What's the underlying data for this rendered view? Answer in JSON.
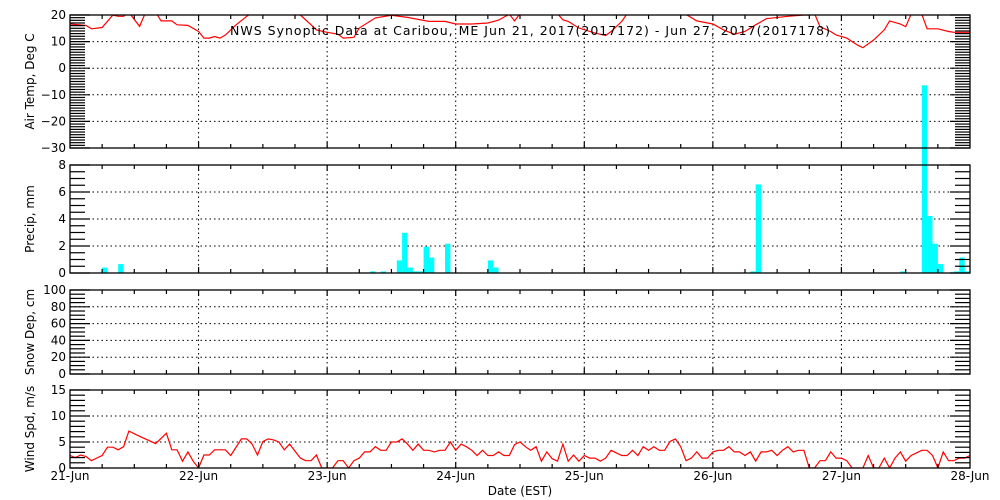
{
  "chart_data": {
    "title": "NWS Synoptic Data at Caribou, ME   Jun 21, 2017(2017172) - Jun 27, 2017(2017178)",
    "xlabel": "Date (EST)",
    "x_units": "hours since 21-Jun 00:00 EST",
    "xlim": [
      0,
      168
    ],
    "xtick_values": [
      0,
      24,
      48,
      72,
      96,
      120,
      144,
      168
    ],
    "xtick_labels": [
      "21-Jun",
      "22-Jun",
      "23-Jun",
      "24-Jun",
      "25-Jun",
      "26-Jun",
      "27-Jun",
      "28-Jun"
    ],
    "grid": true,
    "panels": [
      {
        "type": "line",
        "id": "air-temp",
        "ylabel": "Air Temp, Deg C",
        "ylim": [
          -30,
          20
        ],
        "ytick_values": [
          20,
          10,
          0,
          -10,
          -20,
          -30
        ],
        "ytick_labels": [
          "20",
          "10",
          "0",
          "−10",
          "−20",
          "−30"
        ],
        "color": "#ff0000",
        "points": [
          [
            0,
            16.6
          ],
          [
            3,
            16.1
          ],
          [
            4,
            14.8
          ],
          [
            6,
            15.3
          ],
          [
            8,
            20
          ],
          [
            9,
            19.5
          ],
          [
            10,
            19.5
          ],
          [
            11,
            21
          ],
          [
            13,
            15.7
          ],
          [
            14,
            20.5
          ],
          [
            16,
            21
          ],
          [
            17,
            17.8
          ],
          [
            19,
            17.8
          ],
          [
            20,
            16.3
          ],
          [
            22,
            16.1
          ],
          [
            24,
            13.8
          ],
          [
            25,
            11.3
          ],
          [
            26,
            11.3
          ],
          [
            27,
            11.9
          ],
          [
            28,
            11.3
          ],
          [
            29,
            12.5
          ],
          [
            31,
            16.3
          ],
          [
            33,
            19.5
          ],
          [
            34,
            21
          ],
          [
            38,
            22
          ],
          [
            43,
            20
          ],
          [
            45,
            16.3
          ],
          [
            46,
            14.4
          ],
          [
            48,
            13.5
          ],
          [
            50,
            12.8
          ],
          [
            51,
            11.3
          ],
          [
            53,
            11.6
          ],
          [
            54,
            15.1
          ],
          [
            57,
            18.9
          ],
          [
            60,
            19.9
          ],
          [
            63,
            19.1
          ],
          [
            67,
            17.6
          ],
          [
            70,
            17.6
          ],
          [
            72,
            16.6
          ],
          [
            75,
            16.6
          ],
          [
            78,
            17
          ],
          [
            80,
            18.1
          ],
          [
            82,
            20.3
          ],
          [
            83,
            17.8
          ],
          [
            84,
            20.5
          ],
          [
            88,
            22
          ],
          [
            91,
            20.5
          ],
          [
            92,
            18.2
          ],
          [
            93,
            17.6
          ],
          [
            95,
            15.1
          ],
          [
            98,
            13.2
          ],
          [
            100,
            12.3
          ],
          [
            101,
            13.8
          ],
          [
            103,
            17.6
          ],
          [
            104,
            20.5
          ],
          [
            109,
            22
          ],
          [
            115,
            20.2
          ],
          [
            117,
            17.8
          ],
          [
            120,
            16.6
          ],
          [
            122,
            14.4
          ],
          [
            124,
            12.8
          ],
          [
            126,
            13.8
          ],
          [
            128,
            16.3
          ],
          [
            130,
            18.6
          ],
          [
            134,
            19.5
          ],
          [
            137,
            20
          ],
          [
            138,
            20
          ],
          [
            139,
            20.5
          ],
          [
            140,
            15.6
          ],
          [
            142,
            13.8
          ],
          [
            143,
            12.5
          ],
          [
            145,
            11.3
          ],
          [
            147,
            8.7
          ],
          [
            148,
            7.7
          ],
          [
            150,
            10.6
          ],
          [
            152,
            14.4
          ],
          [
            153,
            17.8
          ],
          [
            155,
            16.6
          ],
          [
            156,
            15.6
          ],
          [
            157,
            20.3
          ],
          [
            158,
            22
          ],
          [
            159,
            20.3
          ],
          [
            160,
            14.8
          ],
          [
            162,
            14.8
          ],
          [
            164,
            13.8
          ],
          [
            165,
            13.5
          ],
          [
            168,
            13.5
          ]
        ]
      },
      {
        "type": "bar",
        "id": "precip",
        "ylabel": "Precip, mm",
        "ylim": [
          0,
          8
        ],
        "ytick_values": [
          0,
          2,
          4,
          6,
          8
        ],
        "ytick_labels": [
          "0",
          "2",
          "4",
          "6",
          "8"
        ],
        "color": "#00ffff",
        "bar_width_hours": 1,
        "bars": [
          [
            6,
            0.4
          ],
          [
            9,
            0.66
          ],
          [
            56,
            0.12
          ],
          [
            58,
            0.12
          ],
          [
            61,
            0.93
          ],
          [
            62,
            2.98
          ],
          [
            63,
            0.41
          ],
          [
            64,
            0.12
          ],
          [
            65,
            0.12
          ],
          [
            66,
            1.95
          ],
          [
            67,
            1.15
          ],
          [
            70,
            2.17
          ],
          [
            78,
            0.93
          ],
          [
            79,
            0.41
          ],
          [
            127,
            0.12
          ],
          [
            128,
            6.56
          ],
          [
            155,
            0.12
          ],
          [
            159,
            13.9
          ],
          [
            160,
            4.22
          ],
          [
            161,
            2.17
          ],
          [
            162,
            0.66
          ],
          [
            165,
            0.12
          ],
          [
            166,
            1.15
          ],
          [
            167,
            0.12
          ]
        ]
      },
      {
        "type": "line",
        "id": "snow-depth",
        "ylabel": "Snow Dep, cm",
        "ylim": [
          0,
          100
        ],
        "ytick_values": [
          0,
          20,
          40,
          60,
          80,
          100
        ],
        "ytick_labels": [
          "0",
          "20",
          "40",
          "60",
          "80",
          "100"
        ],
        "color": "#ff0000",
        "points": []
      },
      {
        "type": "line",
        "id": "wind-speed",
        "ylabel": "Wind Spd, m/s",
        "ylim": [
          0,
          15
        ],
        "ytick_values": [
          0,
          5,
          10,
          15
        ],
        "ytick_labels": [
          "0",
          "5",
          "10",
          "15"
        ],
        "color": "#ff0000",
        "points": [
          [
            0,
            2.4
          ],
          [
            1,
            2.0
          ],
          [
            2,
            2.5
          ],
          [
            3,
            2.2
          ],
          [
            4,
            1.4
          ],
          [
            6,
            2.4
          ],
          [
            7,
            4.0
          ],
          [
            8,
            4.0
          ],
          [
            9,
            3.5
          ],
          [
            10,
            4.1
          ],
          [
            11,
            7.1
          ],
          [
            13,
            6.1
          ],
          [
            16,
            4.7
          ],
          [
            18,
            6.7
          ],
          [
            19,
            3.5
          ],
          [
            20,
            3.5
          ],
          [
            21,
            1.3
          ],
          [
            22,
            3.1
          ],
          [
            23,
            1.3
          ],
          [
            24,
            0
          ],
          [
            25,
            2.5
          ],
          [
            26,
            2.5
          ],
          [
            27,
            3.5
          ],
          [
            29,
            3.5
          ],
          [
            30,
            2.4
          ],
          [
            32,
            5.6
          ],
          [
            33,
            5.6
          ],
          [
            34,
            4.6
          ],
          [
            35,
            2.5
          ],
          [
            36,
            5.1
          ],
          [
            37,
            5.6
          ],
          [
            38,
            5.4
          ],
          [
            39,
            5.0
          ],
          [
            40,
            3.5
          ],
          [
            41,
            4.6
          ],
          [
            43,
            1.9
          ],
          [
            44,
            1.4
          ],
          [
            45,
            1.4
          ],
          [
            46,
            2.5
          ],
          [
            47,
            0
          ],
          [
            48,
            0
          ],
          [
            49,
            0
          ],
          [
            50,
            1.4
          ],
          [
            51,
            1.4
          ],
          [
            52,
            0
          ],
          [
            53,
            1.4
          ],
          [
            54,
            1.9
          ],
          [
            55,
            3.1
          ],
          [
            56,
            3.1
          ],
          [
            57,
            4.1
          ],
          [
            58,
            3.4
          ],
          [
            59,
            3.4
          ],
          [
            60,
            5.0
          ],
          [
            61,
            5.0
          ],
          [
            62,
            5.6
          ],
          [
            63,
            4.6
          ],
          [
            64,
            3.4
          ],
          [
            65,
            4.6
          ],
          [
            66,
            3.4
          ],
          [
            67,
            3.4
          ],
          [
            68,
            3.1
          ],
          [
            69,
            3.4
          ],
          [
            70,
            3.4
          ],
          [
            71,
            5.0
          ],
          [
            72,
            3.4
          ],
          [
            73,
            4.6
          ],
          [
            74,
            4.1
          ],
          [
            75,
            3.4
          ],
          [
            76,
            2.4
          ],
          [
            77,
            3.4
          ],
          [
            78,
            2.4
          ],
          [
            79,
            2.4
          ],
          [
            80,
            3.1
          ],
          [
            81,
            2.4
          ],
          [
            82,
            2.4
          ],
          [
            83,
            4.5
          ],
          [
            84,
            5.0
          ],
          [
            85,
            4.1
          ],
          [
            86,
            3.4
          ],
          [
            87,
            4.1
          ],
          [
            88,
            1.3
          ],
          [
            89,
            3.1
          ],
          [
            90,
            1.8
          ],
          [
            91,
            1.3
          ],
          [
            92,
            4.6
          ],
          [
            93,
            1.3
          ],
          [
            94,
            2.5
          ],
          [
            95,
            1.3
          ],
          [
            96,
            2.4
          ],
          [
            97,
            1.9
          ],
          [
            98,
            1.9
          ],
          [
            99,
            1.3
          ],
          [
            100,
            1.9
          ],
          [
            101,
            3.4
          ],
          [
            102,
            2.9
          ],
          [
            103,
            2.4
          ],
          [
            104,
            2.4
          ],
          [
            105,
            3.4
          ],
          [
            106,
            2.4
          ],
          [
            107,
            4.1
          ],
          [
            108,
            3.4
          ],
          [
            109,
            4.1
          ],
          [
            110,
            3.4
          ],
          [
            111,
            3.4
          ],
          [
            112,
            5.1
          ],
          [
            113,
            5.6
          ],
          [
            114,
            4.1
          ],
          [
            115,
            1.4
          ],
          [
            116,
            1.9
          ],
          [
            117,
            3.1
          ],
          [
            118,
            1.9
          ],
          [
            119,
            1.9
          ],
          [
            120,
            3.1
          ],
          [
            121,
            3.4
          ],
          [
            122,
            3.4
          ],
          [
            123,
            4.1
          ],
          [
            124,
            3.1
          ],
          [
            125,
            3.1
          ],
          [
            126,
            2.4
          ],
          [
            127,
            3.1
          ],
          [
            128,
            1.3
          ],
          [
            129,
            3.1
          ],
          [
            130,
            3.1
          ],
          [
            131,
            3.4
          ],
          [
            132,
            2.4
          ],
          [
            133,
            3.4
          ],
          [
            134,
            4.1
          ],
          [
            135,
            3.1
          ],
          [
            136,
            3.4
          ],
          [
            137,
            3.4
          ],
          [
            138,
            0
          ],
          [
            139,
            0
          ],
          [
            140,
            1.4
          ],
          [
            141,
            1.4
          ],
          [
            142,
            3.1
          ],
          [
            143,
            1.9
          ],
          [
            144,
            1.9
          ],
          [
            145,
            1.4
          ],
          [
            146,
            0
          ],
          [
            147,
            0
          ],
          [
            148,
            0
          ],
          [
            149,
            2.4
          ],
          [
            150,
            0
          ],
          [
            151,
            0
          ],
          [
            152,
            1.9
          ],
          [
            153,
            0
          ],
          [
            154,
            1.9
          ],
          [
            155,
            3.1
          ],
          [
            156,
            1.3
          ],
          [
            157,
            2.4
          ],
          [
            158,
            2.9
          ],
          [
            159,
            3.4
          ],
          [
            160,
            3.4
          ],
          [
            161,
            2.4
          ],
          [
            162,
            0
          ],
          [
            163,
            3.1
          ],
          [
            164,
            1.4
          ],
          [
            165,
            1.4
          ],
          [
            166,
            1.9
          ],
          [
            167,
            1.9
          ],
          [
            168,
            2.4
          ]
        ]
      }
    ]
  }
}
